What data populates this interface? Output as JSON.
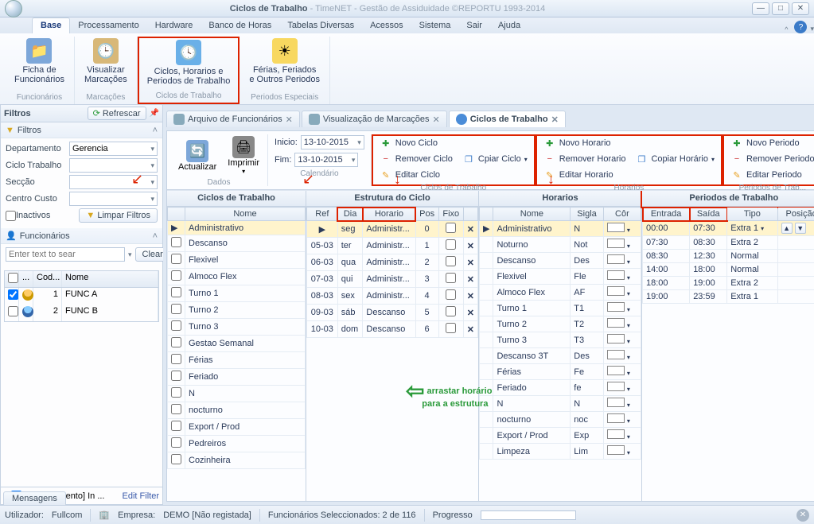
{
  "window": {
    "title_main": "Ciclos de Trabalho",
    "title_sub": " - TimeNET - Gestão de Assiduidade   ©REPORTU 1993-2014"
  },
  "menu": [
    "Base",
    "Processamento",
    "Hardware",
    "Banco de Horas",
    "Tabelas Diversas",
    "Acessos",
    "Sistema",
    "Sair",
    "Ajuda"
  ],
  "ribbon": {
    "g1": {
      "btn": "Ficha de\nFuncionários",
      "cap": "Funcionários"
    },
    "g2": {
      "btn": "Visualizar\nMarcações",
      "cap": "Marcações"
    },
    "g3": {
      "btn": "Ciclos, Horarios e\nPeriodos de Trabalho",
      "cap": "Ciclos de Trabalho"
    },
    "g4": {
      "btn": "Férias, Feriados\ne Outros Periodos",
      "cap": "Periodos Especiais"
    }
  },
  "filters": {
    "title": "Filtros",
    "refresh": "Refrescar",
    "panel": "Filtros",
    "departamento_lbl": "Departamento",
    "departamento_val": "Gerencia",
    "ciclo_lbl": "Ciclo Trabalho",
    "ciclo_val": "",
    "seccao_lbl": "Secção",
    "seccao_val": "",
    "centro_lbl": "Centro Custo",
    "centro_val": "",
    "inactivos": "Inactivos",
    "limpar": "Limpar Filtros",
    "func_panel": "Funcionários",
    "search_ph": "Enter text to sear",
    "clear": "Clear",
    "cols": {
      "a": "...",
      "cod": "Cod...",
      "nome": "Nome"
    },
    "rows": [
      {
        "cod": "1",
        "nome": "FUNC A",
        "chk": true
      },
      {
        "cod": "2",
        "nome": "FUNC B",
        "chk": false
      }
    ],
    "footer_text": "[Departamento] In ...",
    "footer_edit": "Edit Filter"
  },
  "tabs": [
    {
      "label": "Arquivo de Funcionários",
      "active": false
    },
    {
      "label": "Visualização de Marcações",
      "active": false
    },
    {
      "label": "Ciclos de Trabalho",
      "active": true
    }
  ],
  "doctb": {
    "actualizar": "Actualizar",
    "imprimir": "Imprimir",
    "dados_cap": "Dados",
    "inicio": "Inicio:",
    "fim": "Fim:",
    "data1": "13-10-2015",
    "data2": "13-10-2015",
    "cal_cap": "Calendário",
    "ciclos": {
      "novo": "Novo Ciclo",
      "remover": "Remover Ciclo",
      "copiar": "Cpiar Ciclo",
      "editar": "Editar Ciclo",
      "cap": "Ciclos de Trabalho"
    },
    "horarios": {
      "novo": "Novo Horario",
      "remover": "Remover Horario",
      "copiar": "Copiar Horário",
      "editar": "Editar Horario",
      "cap": "Horarios"
    },
    "periodos": {
      "novo": "Novo Periodo",
      "remover": "Remover Periodo",
      "editar": "Editar Periodo",
      "cap": "Periodos de Trab..."
    }
  },
  "panels": {
    "ciclos": {
      "title": "Ciclos de Trabalho",
      "col": "Nome",
      "rows": [
        "Administrativo",
        "Descanso",
        "Flexivel",
        "Almoco Flex",
        "Turno 1",
        "Turno 2",
        "Turno 3",
        "Gestao Semanal",
        "Férias",
        "Feriado",
        "N",
        "nocturno",
        "Export / Prod",
        "Pedreiros",
        "Cozinheira"
      ]
    },
    "estrutura": {
      "title": "Estrutura do Ciclo",
      "cols": {
        "ref": "Ref",
        "dia": "Dia",
        "hor": "Horario",
        "pos": "Pos",
        "fixo": "Fixo"
      },
      "rows": [
        {
          "ref": "",
          "dia": "seg",
          "hor": "Administr...",
          "pos": "0"
        },
        {
          "ref": "05-03",
          "dia": "ter",
          "hor": "Administr...",
          "pos": "1"
        },
        {
          "ref": "06-03",
          "dia": "qua",
          "hor": "Administr...",
          "pos": "2"
        },
        {
          "ref": "07-03",
          "dia": "qui",
          "hor": "Administr...",
          "pos": "3"
        },
        {
          "ref": "08-03",
          "dia": "sex",
          "hor": "Administr...",
          "pos": "4"
        },
        {
          "ref": "09-03",
          "dia": "sáb",
          "hor": "Descanso",
          "pos": "5"
        },
        {
          "ref": "10-03",
          "dia": "dom",
          "hor": "Descanso",
          "pos": "6"
        }
      ]
    },
    "horarios": {
      "title": "Horarios",
      "cols": {
        "nome": "Nome",
        "sigla": "Sigla",
        "cor": "Côr"
      },
      "rows": [
        {
          "nome": "Administrativo",
          "sigla": "N"
        },
        {
          "nome": "Noturno",
          "sigla": "Not"
        },
        {
          "nome": "Descanso",
          "sigla": "Des"
        },
        {
          "nome": "Flexivel",
          "sigla": "Fle"
        },
        {
          "nome": "Almoco Flex",
          "sigla": "AF"
        },
        {
          "nome": "Turno 1",
          "sigla": "T1"
        },
        {
          "nome": "Turno 2",
          "sigla": "T2"
        },
        {
          "nome": "Turno 3",
          "sigla": "T3"
        },
        {
          "nome": "Descanso 3T",
          "sigla": "Des"
        },
        {
          "nome": "Férias",
          "sigla": "Fe"
        },
        {
          "nome": "Feriado",
          "sigla": "fe"
        },
        {
          "nome": "N",
          "sigla": "N"
        },
        {
          "nome": "nocturno",
          "sigla": "noc"
        },
        {
          "nome": "Export / Prod",
          "sigla": "Exp"
        },
        {
          "nome": "Limpeza",
          "sigla": "Lim"
        }
      ]
    },
    "periodos": {
      "title": "Periodos de Trabalho",
      "cols": {
        "ent": "Entrada",
        "sai": "Saída",
        "tipo": "Tipo",
        "pos": "Posição"
      },
      "rows": [
        {
          "ent": "00:00",
          "sai": "07:30",
          "tipo": "Extra 1"
        },
        {
          "ent": "07:30",
          "sai": "08:30",
          "tipo": "Extra 2"
        },
        {
          "ent": "08:30",
          "sai": "12:30",
          "tipo": "Normal"
        },
        {
          "ent": "14:00",
          "sai": "18:00",
          "tipo": "Normal"
        },
        {
          "ent": "18:00",
          "sai": "19:00",
          "tipo": "Extra 2"
        },
        {
          "ent": "19:00",
          "sai": "23:59",
          "tipo": "Extra 1"
        }
      ]
    }
  },
  "greentext": {
    "l1": "arrastar horário",
    "l2": "para a estrutura"
  },
  "statusbar": {
    "msgs": "Mensagens",
    "user_lbl": "Utilizador:",
    "user": "Fullcom",
    "emp_lbl": "Empresa:",
    "emp": "DEMO [Não registada]",
    "sel": "Funcionários Seleccionados: 2 de 116",
    "prog": "Progresso"
  }
}
